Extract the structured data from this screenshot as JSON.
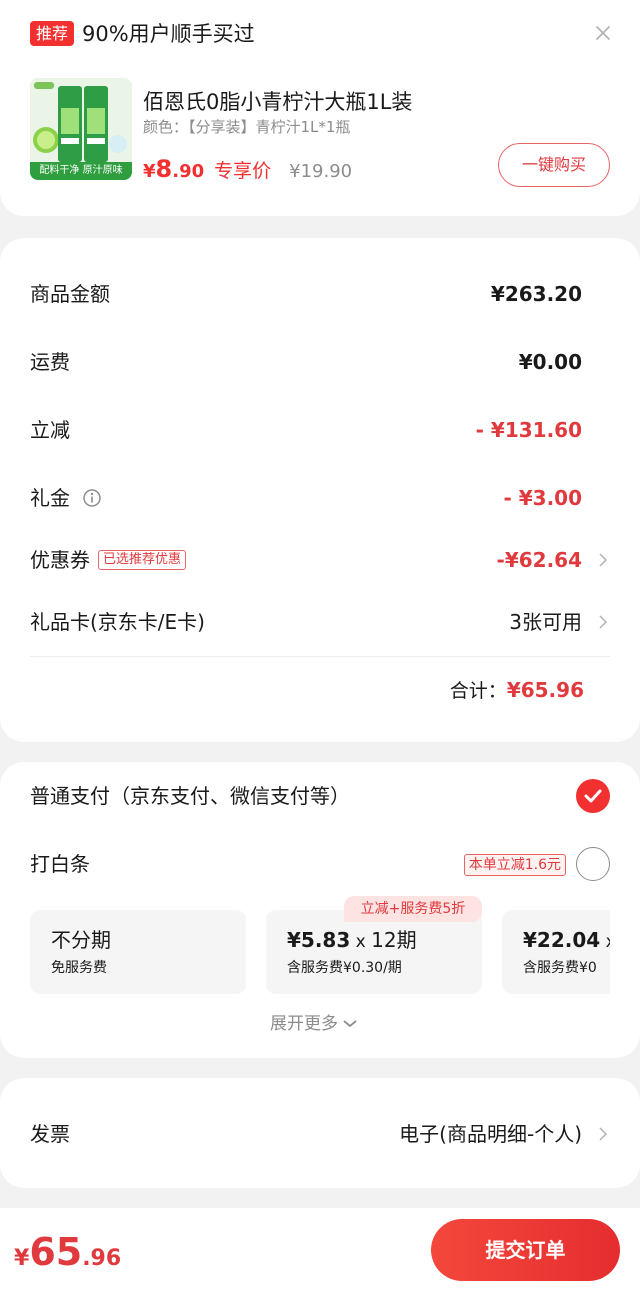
{
  "recommend": {
    "tag": "推荐",
    "title": "90%用户顺手买过",
    "product": {
      "thumb_caption": "配料干净 原汁原味",
      "name": "佰恩氏0脂小青柠汁大瓶1L装",
      "spec": "颜色：【分享装】青柠汁1L*1瓶",
      "price_symbol": "¥",
      "price_int": "8",
      "price_dec": ".90",
      "price_label": "专享价",
      "orig_price": "¥19.90"
    },
    "buy_label": "一键购买"
  },
  "amount": {
    "rows": [
      {
        "label": "商品金额",
        "value": "¥263.20"
      },
      {
        "label": "运费",
        "value": "¥0.00"
      },
      {
        "label": "立减",
        "value": "- ¥131.60"
      },
      {
        "label": "礼金",
        "value": "- ¥3.00"
      },
      {
        "label": "优惠券",
        "tag": "已选推荐优惠",
        "value": "-¥62.64"
      },
      {
        "label": "礼品卡(京东卡/E卡)",
        "value": "3张可用"
      }
    ],
    "total_label": "合计：",
    "total_value": "¥65.96"
  },
  "payment": {
    "normal_label": "普通支付（京东支付、微信支付等）",
    "normal_selected": true,
    "baitiao_label": "打白条",
    "baitiao_tag": "本单立减1.6元",
    "baitiao_selected": false,
    "plan_badge": "立减+服务费5折",
    "plans": [
      {
        "title": "不分期",
        "sub": "免服务费"
      },
      {
        "amount": "¥5.83",
        "times": " x ",
        "period": "12期",
        "sub": "含服务费¥0.30/期"
      },
      {
        "amount": "¥22.04",
        "times": " x",
        "sub": "含服务费¥0"
      }
    ],
    "expand_label": "展开更多"
  },
  "invoice": {
    "label": "发票",
    "value": "电子(商品明细-个人)"
  },
  "bottom": {
    "price_symbol": "¥",
    "price_int": "65",
    "price_dec": ".96",
    "submit_label": "提交订单"
  },
  "colors": {
    "accent": "#e0393e",
    "tag_red": "#f23030",
    "muted": "#8c8c8c"
  }
}
